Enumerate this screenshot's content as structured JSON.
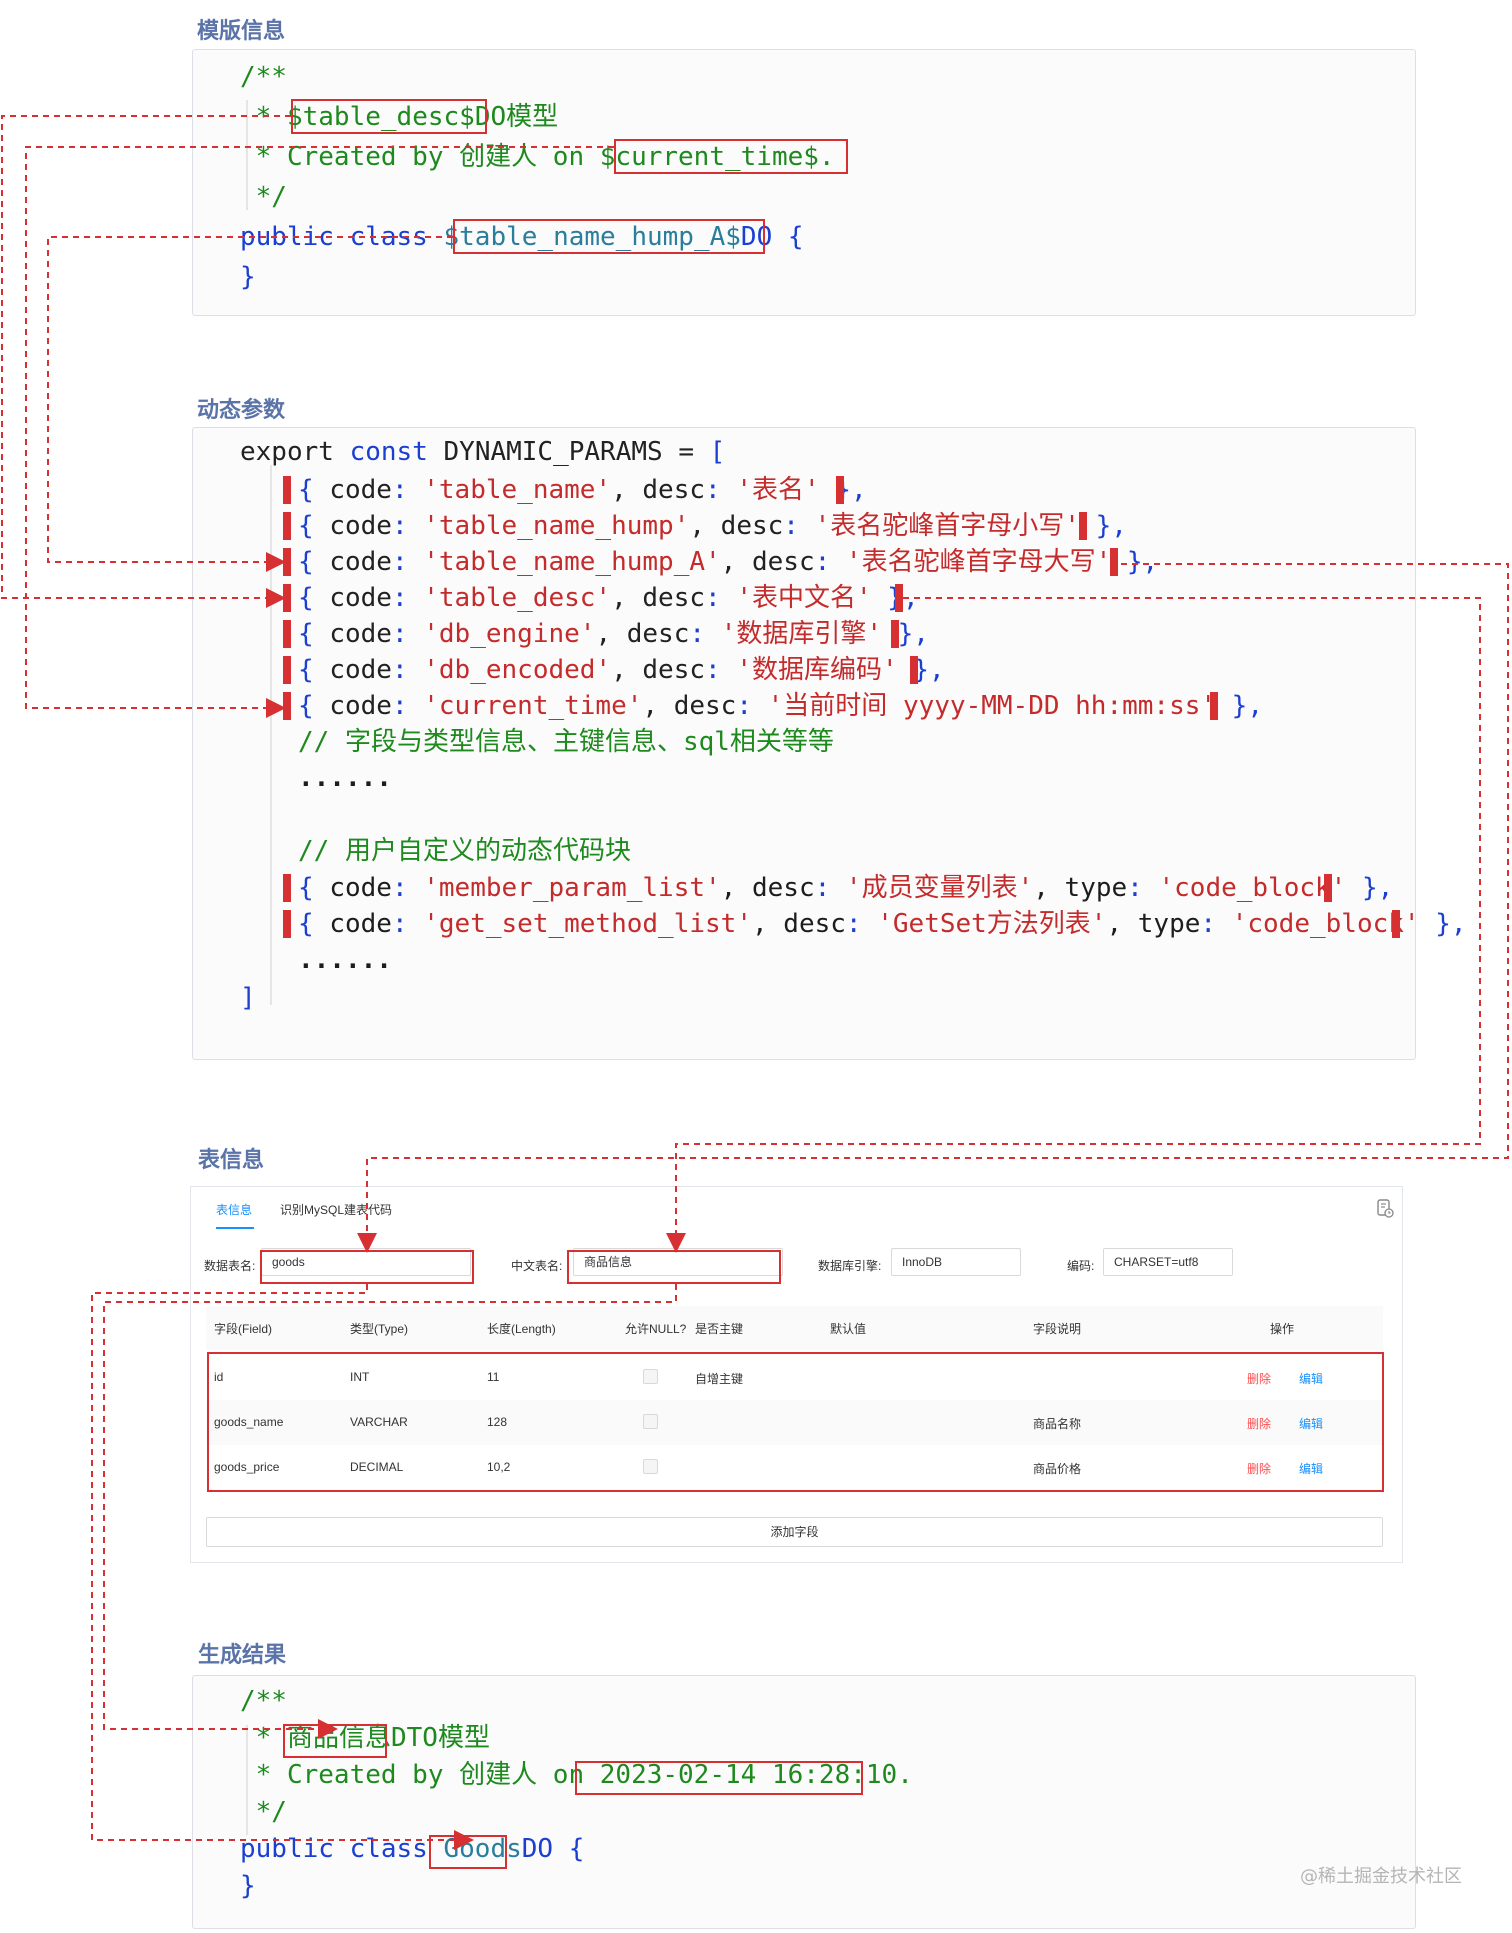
{
  "sections": {
    "template": "模版信息",
    "params": "动态参数",
    "table": "表信息",
    "result": "生成结果"
  },
  "template_code": {
    "line1": "/**",
    "line2_star": " * ",
    "line2_var": "$table_desc$",
    "line2_rest": "DO模型",
    "line3_pre": " * Created by 创建人 on ",
    "line3_var": "$current_time$",
    "line3_post": ".",
    "line4": " */",
    "line5_pre": "public class ",
    "line5_var": "$table_name_hump_A$",
    "line5_post": "DO {",
    "line6": "}"
  },
  "params_code": {
    "head_kw1": "export",
    "head_kw2": "const",
    "head_name": "DYNAMIC_PARAMS",
    "head_eq": " = ",
    "head_bracket": "[",
    "rows": [
      {
        "code": "'table_name'",
        "desc": "'表名'",
        "tail": " },"
      },
      {
        "code": "'table_name_hump'",
        "desc": "'表名驼峰首字母小写'",
        "tail": " },"
      },
      {
        "code": "'table_name_hump_A'",
        "desc": "'表名驼峰首字母大写'",
        "tail": " },"
      },
      {
        "code": "'table_desc'",
        "desc": "'表中文名'",
        "tail": " },"
      },
      {
        "code": "'db_engine'",
        "desc": "'数据库引擎'",
        "tail": " },"
      },
      {
        "code": "'db_encoded'",
        "desc": "'数据库编码'",
        "tail": " },"
      },
      {
        "code": "'current_time'",
        "desc": "'当前时间 yyyy-MM-DD hh:mm:ss'",
        "tail": " },"
      }
    ],
    "comment1": "// 字段与类型信息、主键信息、sql相关等等",
    "dots1": "......",
    "comment2": "// 用户自定义的动态代码块",
    "rows2": [
      {
        "code": "'member_param_list'",
        "desc": "'成员变量列表'",
        "type": "'code_block'",
        "tail": " },"
      },
      {
        "code": "'get_set_method_list'",
        "desc": "'GetSet方法列表'",
        "type": "'code_block'",
        "tail": " },"
      }
    ],
    "dots2": "......",
    "close": "]",
    "kw_code": "code",
    "kw_desc": "desc",
    "kw_type": "type"
  },
  "table_panel": {
    "tabs": [
      "表信息",
      "识别MySQL建表代码"
    ],
    "form": {
      "table_name_label": "数据表名:",
      "table_name_value": "goods",
      "cn_name_label": "中文表名:",
      "cn_name_value": "商品信息",
      "engine_label": "数据库引擎:",
      "engine_value": "InnoDB",
      "encoding_label": "编码:",
      "encoding_value": "CHARSET=utf8"
    },
    "columns": [
      "字段(Field)",
      "类型(Type)",
      "长度(Length)",
      "允许NULL?",
      "是否主键",
      "默认值",
      "字段说明",
      "操作"
    ],
    "rows": [
      {
        "field": "id",
        "type": "INT",
        "length": "11",
        "pk": "自增主键",
        "default": "",
        "comment": "",
        "del": "删除",
        "edit": "编辑"
      },
      {
        "field": "goods_name",
        "type": "VARCHAR",
        "length": "128",
        "pk": "",
        "default": "",
        "comment": "商品名称",
        "del": "删除",
        "edit": "编辑"
      },
      {
        "field": "goods_price",
        "type": "DECIMAL",
        "length": "10,2",
        "pk": "",
        "default": "",
        "comment": "商品价格",
        "del": "删除",
        "edit": "编辑"
      }
    ],
    "add_button": "添加字段"
  },
  "result_code": {
    "line1": "/**",
    "line2_star": " * ",
    "line2_var": "商品信息",
    "line2_rest": "DTO模型",
    "line3_pre": " * Created by 创建人 on ",
    "line3_var": "2023-02-14 16:28:10",
    "line3_post": ".",
    "line4": " */",
    "line5_pre": "public class ",
    "line5_var": "Goods",
    "line5_post": "DO {",
    "line6": "}"
  },
  "watermark": "@稀土掘金技术社区",
  "colors": {
    "accent_red": "#d63033",
    "section_title": "#5a73a8",
    "comment_green": "#1e8a1e",
    "keyword_blue": "#1a3fd1",
    "string_red": "#c42b2b",
    "var_teal": "#2a7e9c",
    "link_blue": "#1890ff"
  }
}
